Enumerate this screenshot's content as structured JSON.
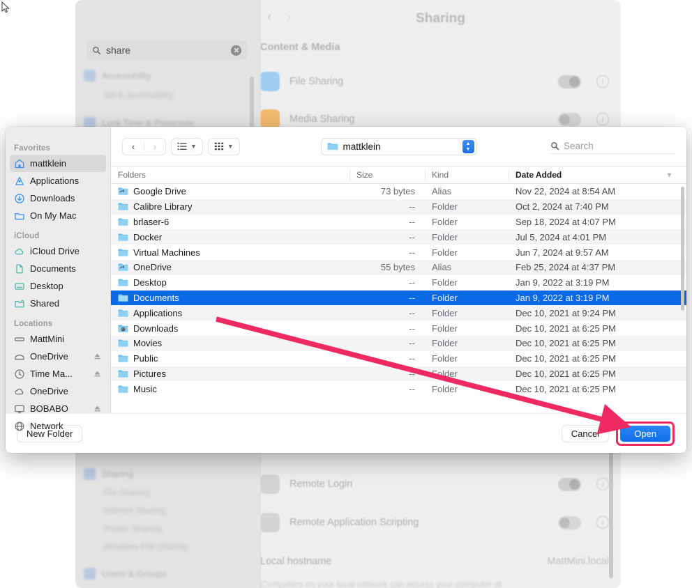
{
  "background_window": {
    "name": "system-settings",
    "title": "Sharing",
    "search": {
      "value": "share",
      "placeholder": "Search"
    },
    "sidebar_items": [
      {
        "label": "Accessibility",
        "sub": "Siri & Accessibility"
      },
      {
        "label": "Lock Time & Passcode",
        "sub": ""
      },
      {
        "label": "Sharing",
        "sub": ""
      },
      {
        "label": "File Sharing",
        "sub": ""
      },
      {
        "label": "Internet Sharing",
        "sub": ""
      },
      {
        "label": "Printer Sharing",
        "sub": ""
      },
      {
        "label": "Windows File Sharing",
        "sub": ""
      },
      {
        "label": "Users & Groups",
        "sub": ""
      }
    ],
    "section_heading": "Content & Media",
    "rows": [
      {
        "label": "File Sharing",
        "toggle": "on",
        "icon_color": "#7fc4f0"
      },
      {
        "label": "Media Sharing",
        "toggle": "off",
        "icon_color": "#f0a94f"
      },
      {
        "label": "Remote Login",
        "toggle": "on",
        "icon_color": "#c9c9cc"
      },
      {
        "label": "Remote Application Scripting",
        "toggle": "off",
        "icon_color": "#c9c9cc"
      }
    ],
    "hostname_label": "Local hostname",
    "hostname_value": "MattMini.local",
    "hostname_note": "Computers on your local network can access your computer at"
  },
  "dialog": {
    "name": "open-file-panel",
    "toolbar": {
      "back_label": "‹",
      "forward_label": "›",
      "list_view_label": "list-view",
      "icon_view_label": "icon-view",
      "path_name": "mattklein",
      "search_placeholder": "Search"
    },
    "sidebar": {
      "groups": [
        {
          "title": "Favorites",
          "items": [
            {
              "label": "mattklein",
              "icon": "home-icon",
              "selected": true,
              "eject": false
            },
            {
              "label": "Applications",
              "icon": "applications-icon",
              "selected": false,
              "eject": false
            },
            {
              "label": "Downloads",
              "icon": "downloads-icon",
              "selected": false,
              "eject": false
            },
            {
              "label": "On My Mac",
              "icon": "folder-icon",
              "selected": false,
              "eject": false
            }
          ]
        },
        {
          "title": "iCloud",
          "items": [
            {
              "label": "iCloud Drive",
              "icon": "cloud-icon",
              "selected": false,
              "eject": false
            },
            {
              "label": "Documents",
              "icon": "document-icon",
              "selected": false,
              "eject": false
            },
            {
              "label": "Desktop",
              "icon": "desktop-icon",
              "selected": false,
              "eject": false
            },
            {
              "label": "Shared",
              "icon": "shared-folder-icon",
              "selected": false,
              "eject": false
            }
          ]
        },
        {
          "title": "Locations",
          "items": [
            {
              "label": "MattMini",
              "icon": "drive-icon",
              "selected": false,
              "eject": false
            },
            {
              "label": "OneDrive",
              "icon": "external-disk-icon",
              "selected": false,
              "eject": true
            },
            {
              "label": "Time Ma...",
              "icon": "time-machine-icon",
              "selected": false,
              "eject": true
            },
            {
              "label": "OneDrive",
              "icon": "cloud-icon",
              "selected": false,
              "eject": false
            },
            {
              "label": "BOBABO",
              "icon": "display-icon",
              "selected": false,
              "eject": true
            },
            {
              "label": "Network",
              "icon": "network-icon",
              "selected": false,
              "eject": false
            }
          ]
        }
      ]
    },
    "columns": [
      {
        "key": "name",
        "label": "Folders",
        "sorted": false
      },
      {
        "key": "size",
        "label": "Size",
        "sorted": false
      },
      {
        "key": "kind",
        "label": "Kind",
        "sorted": false
      },
      {
        "key": "date",
        "label": "Date Added",
        "sorted": true
      }
    ],
    "rows": [
      {
        "name": "Google Drive",
        "size": "73 bytes",
        "kind": "Alias",
        "date": "Nov 22, 2024 at 8:54 AM",
        "icon": "alias-folder-icon",
        "selected": false
      },
      {
        "name": "Calibre Library",
        "size": "--",
        "kind": "Folder",
        "date": "Oct 2, 2024 at 7:40 PM",
        "icon": "folder-icon",
        "selected": false
      },
      {
        "name": "brlaser-6",
        "size": "--",
        "kind": "Folder",
        "date": "Sep 18, 2024 at 4:07 PM",
        "icon": "folder-icon",
        "selected": false
      },
      {
        "name": "Docker",
        "size": "--",
        "kind": "Folder",
        "date": "Jul 5, 2024 at 4:01 PM",
        "icon": "folder-icon",
        "selected": false
      },
      {
        "name": "Virtual Machines",
        "size": "--",
        "kind": "Folder",
        "date": "Jun 7, 2024 at 9:57 AM",
        "icon": "folder-icon",
        "selected": false
      },
      {
        "name": "OneDrive",
        "size": "55 bytes",
        "kind": "Alias",
        "date": "Feb 25, 2024 at 4:37 PM",
        "icon": "alias-folder-icon",
        "selected": false
      },
      {
        "name": "Desktop",
        "size": "--",
        "kind": "Folder",
        "date": "Jan 9, 2022 at 3:19 PM",
        "icon": "folder-icon",
        "selected": false
      },
      {
        "name": "Documents",
        "size": "--",
        "kind": "Folder",
        "date": "Jan 9, 2022 at 3:19 PM",
        "icon": "folder-icon",
        "selected": true
      },
      {
        "name": "Applications",
        "size": "--",
        "kind": "Folder",
        "date": "Dec 10, 2021 at 9:24 PM",
        "icon": "folder-icon",
        "selected": false
      },
      {
        "name": "Downloads",
        "size": "--",
        "kind": "Folder",
        "date": "Dec 10, 2021 at 6:25 PM",
        "icon": "downloads-folder-icon",
        "selected": false
      },
      {
        "name": "Movies",
        "size": "--",
        "kind": "Folder",
        "date": "Dec 10, 2021 at 6:25 PM",
        "icon": "folder-icon",
        "selected": false
      },
      {
        "name": "Public",
        "size": "--",
        "kind": "Folder",
        "date": "Dec 10, 2021 at 6:25 PM",
        "icon": "folder-icon",
        "selected": false
      },
      {
        "name": "Pictures",
        "size": "--",
        "kind": "Folder",
        "date": "Dec 10, 2021 at 6:25 PM",
        "icon": "folder-icon",
        "selected": false
      },
      {
        "name": "Music",
        "size": "--",
        "kind": "Folder",
        "date": "Dec 10, 2021 at 6:25 PM",
        "icon": "folder-icon",
        "selected": false
      }
    ],
    "buttons": {
      "new_folder": "New Folder",
      "cancel": "Cancel",
      "open": "Open"
    }
  },
  "annotation": {
    "type": "arrow",
    "color": "#ef2a63",
    "from": "Documents row",
    "to": "Open button"
  },
  "colors": {
    "selection_blue": "#0a69e4",
    "accent_pink": "#ef2a63",
    "sidebar_bg": "#ececed",
    "row_alt": "#f4f4f6"
  }
}
